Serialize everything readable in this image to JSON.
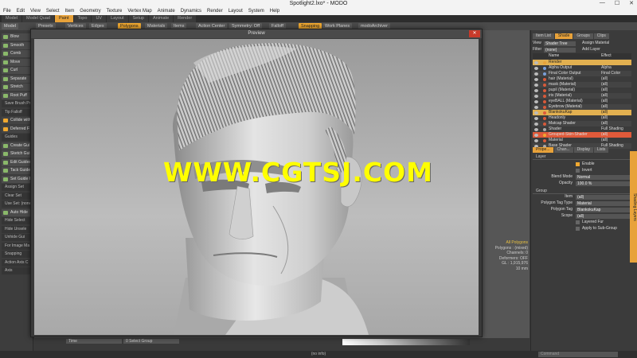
{
  "window": {
    "title": "Spotlight2.lxo* - MODO"
  },
  "menu": [
    "File",
    "Edit",
    "View",
    "Select",
    "Item",
    "Geometry",
    "Texture",
    "Vertex Map",
    "Animate",
    "Dynamics",
    "Render",
    "Layout",
    "System",
    "Help"
  ],
  "modes": [
    {
      "label": "Model",
      "active": false
    },
    {
      "label": "Model Quad",
      "active": false
    },
    {
      "label": "Paint",
      "active": true
    },
    {
      "label": "Topo",
      "active": false
    },
    {
      "label": "UV",
      "active": false
    },
    {
      "label": "Layout",
      "active": false
    },
    {
      "label": "Setup",
      "active": false
    },
    {
      "label": "Animate",
      "active": false
    },
    {
      "label": "Render",
      "active": false
    }
  ],
  "toolbar": {
    "model": "Model",
    "presets": "Presets",
    "vertices": "Vertices",
    "edges": "Edges",
    "polygons": "Polygons",
    "materials": "Materials",
    "items": "Items",
    "action_center": "Action Center",
    "symmetry": "Symmetry: Off",
    "falloff": "Falloff",
    "snapping": "Snapping",
    "work_planes": "Work Planes",
    "modo_archiver": "modoArchiver"
  },
  "left_tools": [
    {
      "label": "Blow",
      "type": "tool"
    },
    {
      "label": "Smooth",
      "type": "tool"
    },
    {
      "label": "Comb",
      "type": "tool"
    },
    {
      "label": "Move",
      "type": "tool"
    },
    {
      "label": "Curl",
      "type": "tool"
    },
    {
      "label": "Separate",
      "type": "tool"
    },
    {
      "label": "Stretch",
      "type": "tool"
    },
    {
      "label": "Root Puff",
      "type": "tool"
    },
    {
      "label": "Save Brush Pre",
      "type": "header"
    },
    {
      "label": "Tip Falloff",
      "type": "header"
    },
    {
      "label": "Collide with",
      "type": "check"
    },
    {
      "label": "Deferred F",
      "type": "check"
    },
    {
      "label": "Guides",
      "type": "header"
    },
    {
      "label": "Create Gui",
      "type": "tool"
    },
    {
      "label": "Sketch Gui",
      "type": "tool"
    },
    {
      "label": "Edit Guides",
      "type": "tool"
    },
    {
      "label": "Tack Guides",
      "type": "tool"
    },
    {
      "label": "Set Guide C",
      "type": "tool"
    },
    {
      "label": "Assign Set",
      "type": "header"
    },
    {
      "label": "Clear Set",
      "type": "header"
    },
    {
      "label": "Use Set: (none",
      "type": "header"
    },
    {
      "label": "Auto Hide",
      "type": "tool"
    },
    {
      "label": "Hide Select",
      "type": "header"
    },
    {
      "label": "Hide Unsele",
      "type": "header"
    },
    {
      "label": "Unhide Gui",
      "type": "header"
    },
    {
      "label": "For Image Ma",
      "type": "header"
    },
    {
      "label": "Snapping",
      "type": "header"
    },
    {
      "label": "Action Axis C",
      "type": "header"
    },
    {
      "label": "Axis",
      "type": "header"
    }
  ],
  "viewport": {
    "tabs": [
      "Views",
      "Ray (Shad...",
      "Rendering",
      "GPT sh.UT"
    ],
    "tabs2": [
      "(Render Camera)",
      "1",
      "Update"
    ],
    "stats": {
      "title": "All Polygons",
      "polygons": "Polygons : (mixed)",
      "channels": "Channels: 0",
      "deformers": "Deformers: OFF",
      "gl": "GL : 1,915,976",
      "size": "10 mm"
    }
  },
  "preview": {
    "title": "Preview",
    "close": "✕"
  },
  "watermark": "WWW.CGTSJ.COM",
  "shader_tree": {
    "tabs": [
      {
        "label": "Item List",
        "active": false
      },
      {
        "label": "Shade",
        "active": true
      },
      {
        "label": "Groups",
        "active": false
      },
      {
        "label": "Clips",
        "active": false
      }
    ],
    "view_label": "View",
    "view_value": "Shader Tree",
    "assign_material": "Assign Material",
    "filter_label": "Filter",
    "filter_value": "(none)",
    "add_layer": "Add Layer",
    "col_name": "Name",
    "col_effect": "Effect",
    "rows": [
      {
        "name": "Render",
        "effect": "",
        "style": "hl2",
        "color": "#e8a23a"
      },
      {
        "name": "Alpha Output",
        "effect": "Alpha",
        "style": "",
        "color": "#7aa0d8"
      },
      {
        "name": "Final Color Output",
        "effect": "Final Color",
        "style": "alt",
        "color": "#7aa0d8"
      },
      {
        "name": "hair (Material)",
        "effect": "(all)",
        "style": "",
        "color": "#d85a3a"
      },
      {
        "name": "mask (Material)",
        "effect": "(all)",
        "style": "alt",
        "color": "#d85a3a"
      },
      {
        "name": "pupil (Material)",
        "effect": "(all)",
        "style": "",
        "color": "#d85a3a"
      },
      {
        "name": "iris (Material)",
        "effect": "(all)",
        "style": "alt",
        "color": "#d85a3a"
      },
      {
        "name": "eyeBALL (Material)",
        "effect": "(all)",
        "style": "",
        "color": "#d85a3a"
      },
      {
        "name": "Eyebrow (Material)",
        "effect": "(all)",
        "style": "alt",
        "color": "#d85a3a"
      },
      {
        "name": "BlankokuKap",
        "effect": "(all)",
        "style": "hl2",
        "color": "#e05a3a"
      },
      {
        "name": "Headonly",
        "effect": "(all)",
        "style": "",
        "color": "#d85a3a"
      },
      {
        "name": "Matcap Shader",
        "effect": "(all)",
        "style": "alt",
        "color": "#d85a3a"
      },
      {
        "name": "Shader",
        "effect": "Full Shading",
        "style": "",
        "color": "#aaa"
      },
      {
        "name": "Grouped-Skin-Shader",
        "effect": "(all)",
        "style": "sel",
        "color": "#f0a830"
      },
      {
        "name": "Material",
        "effect": "(all)",
        "style": "",
        "color": "#d85a3a"
      },
      {
        "name": "Base Shader",
        "effect": "Full Shading",
        "style": "alt",
        "color": "#aaa"
      }
    ]
  },
  "properties": {
    "tabs": [
      {
        "label": "Prope...",
        "active": true
      },
      {
        "label": "Chan...",
        "active": false
      },
      {
        "label": "Display",
        "active": false
      },
      {
        "label": "Lists",
        "active": false
      }
    ],
    "layer_section": "Layer",
    "enable": "Enable",
    "invert": "Invert",
    "blend_mode_label": "Blend Mode",
    "blend_mode_value": "Normal",
    "opacity_label": "Opacity",
    "opacity_value": "100.0 %",
    "group_section": "Group",
    "item_label": "Item",
    "item_value": "(all)",
    "ptt_label": "Polygon Tag Type",
    "ptt_value": "Material",
    "ptag_label": "Polygon Tag",
    "ptag_value": "BlankokuKap",
    "scope_label": "Scope",
    "scope_value": "(all)",
    "layered_fur": "Layered Fur",
    "apply_subgroup": "Apply to Sub-Group",
    "side_tab": "Shading Layers"
  },
  "bottom": {
    "field1": "Time",
    "field2": "0 Select Group",
    "status": "(no info)",
    "command": "Command"
  }
}
